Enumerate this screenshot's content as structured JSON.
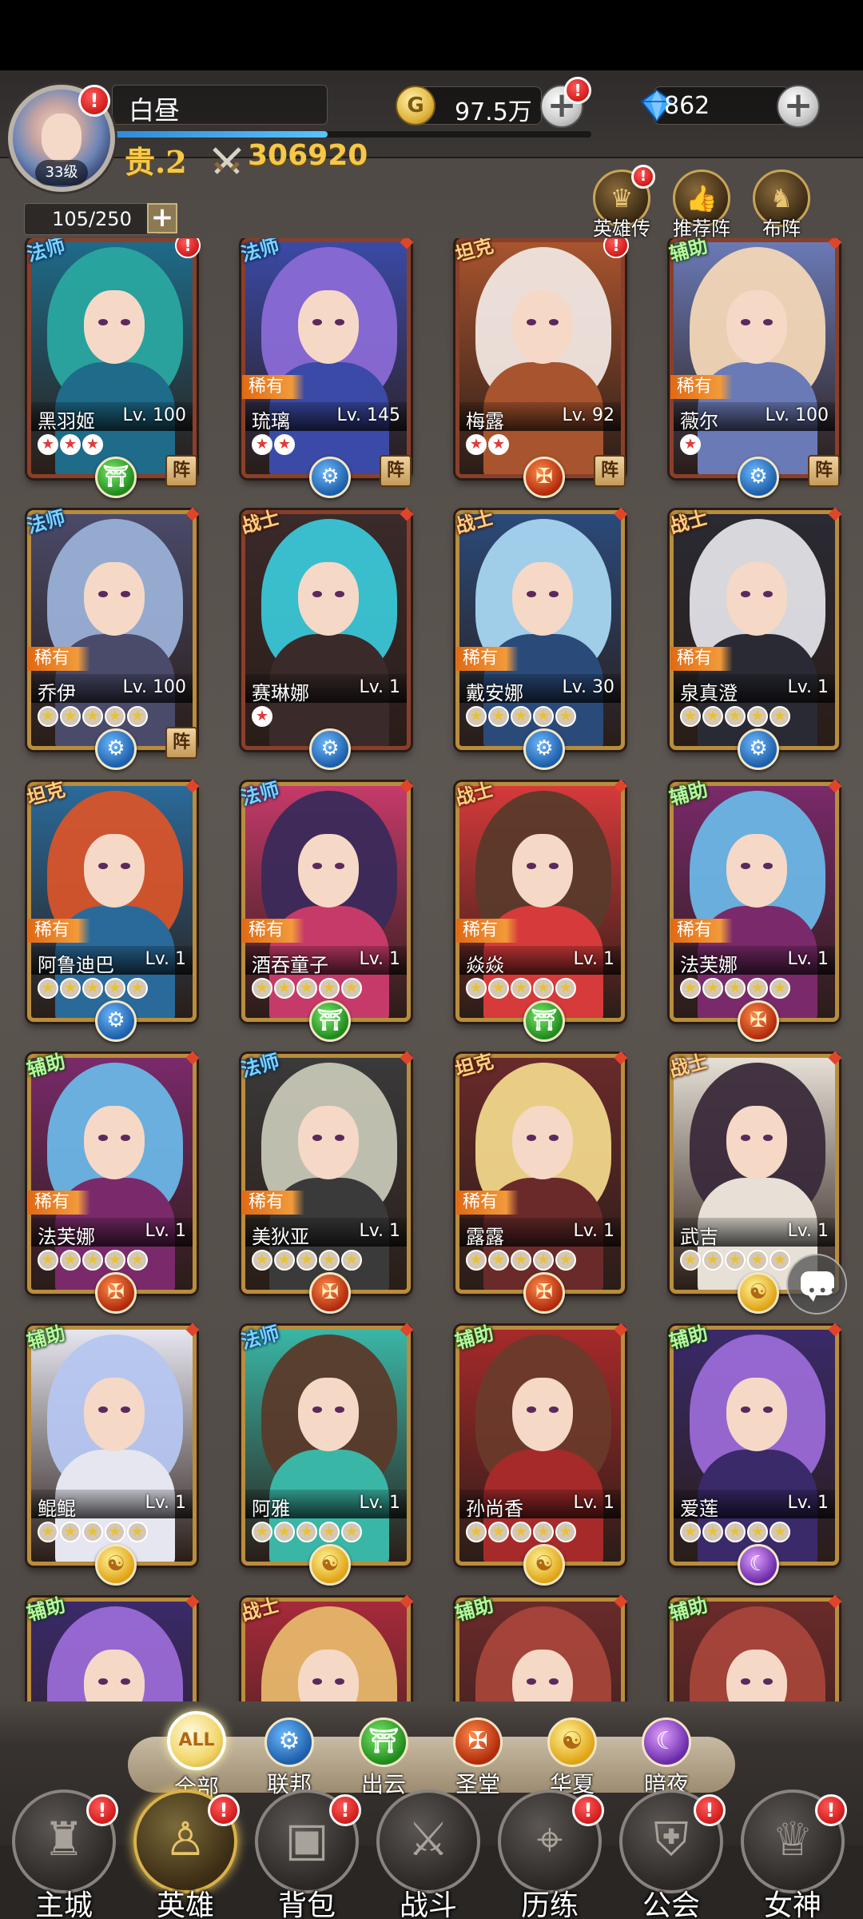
{
  "player": {
    "name": "白昼",
    "level": "33级",
    "vip": "贵.2",
    "power": "306920",
    "exp_progress": 0.45,
    "avatar_badge": "!"
  },
  "resources": {
    "gold": "97.5万",
    "gold_icon": "G",
    "gold_badge": "!",
    "gems": "862"
  },
  "roster": {
    "count": "105/250"
  },
  "side_buttons": [
    {
      "label": "英雄传",
      "icon": "crown-icon",
      "glyph": "♛",
      "badge": "!"
    },
    {
      "label": "推荐阵",
      "icon": "thumbs-up-icon",
      "glyph": "👍"
    },
    {
      "label": "布阵",
      "icon": "horse-icon",
      "glyph": "♞"
    }
  ],
  "heroes": [
    {
      "name": "黑羽姬",
      "level": "Lv. 100",
      "role": "法师",
      "role_type": "mage",
      "rare": "",
      "stars": 3,
      "star_color": "red",
      "faction": "green",
      "faction_glyph": "⛩",
      "formation": "阵",
      "badge": "!",
      "frame": "red",
      "hair": "#2aa6a0",
      "body": "#1e6b8a"
    },
    {
      "name": "琉璃",
      "level": "Lv. 145",
      "role": "法师",
      "role_type": "mage",
      "rare": "稀有",
      "stars": 2,
      "star_color": "red",
      "faction": "blue",
      "faction_glyph": "⚙",
      "formation": "阵",
      "badge": "",
      "frame": "red",
      "hair": "#8a6ad6",
      "body": "#3a4aa6"
    },
    {
      "name": "梅露",
      "level": "Lv. 92",
      "role": "坦克",
      "role_type": "tank",
      "rare": "",
      "stars": 2,
      "star_color": "red",
      "faction": "red",
      "faction_glyph": "✠",
      "formation": "阵",
      "badge": "!",
      "frame": "red",
      "hair": "#f0e6e0",
      "body": "#a8542e"
    },
    {
      "name": "薇尔",
      "level": "Lv. 100",
      "role": "辅助",
      "role_type": "support",
      "rare": "稀有",
      "stars": 1,
      "star_color": "red",
      "faction": "blue",
      "faction_glyph": "⚙",
      "formation": "阵",
      "badge": "",
      "frame": "red",
      "hair": "#f2d6b6",
      "body": "#6a7ab6"
    },
    {
      "name": "乔伊",
      "level": "Lv. 100",
      "role": "法师",
      "role_type": "mage",
      "rare": "稀有",
      "stars": 5,
      "star_color": "gold",
      "faction": "blue",
      "faction_glyph": "⚙",
      "formation": "阵",
      "badge": "",
      "frame": "gold",
      "hair": "#9ab0d6",
      "body": "#4a4a6a"
    },
    {
      "name": "赛琳娜",
      "level": "Lv. 1",
      "role": "战士",
      "role_type": "warrior",
      "rare": "",
      "stars": 1,
      "star_color": "red",
      "faction": "blue",
      "faction_glyph": "⚙",
      "formation": "",
      "badge": "",
      "frame": "red",
      "hair": "#3ac6d6",
      "body": "#3a2a2a"
    },
    {
      "name": "戴安娜",
      "level": "Lv. 30",
      "role": "战士",
      "role_type": "warrior",
      "rare": "稀有",
      "stars": 5,
      "star_color": "gold",
      "faction": "blue",
      "faction_glyph": "⚙",
      "formation": "",
      "badge": "",
      "frame": "gold",
      "hair": "#a6d6f0",
      "body": "#2a4a7a"
    },
    {
      "name": "泉真澄",
      "level": "Lv. 1",
      "role": "战士",
      "role_type": "warrior",
      "rare": "稀有",
      "stars": 5,
      "star_color": "gold",
      "faction": "blue",
      "faction_glyph": "⚙",
      "formation": "",
      "badge": "",
      "frame": "gold",
      "hair": "#e0e0e6",
      "body": "#2a2a34"
    },
    {
      "name": "阿鲁迪巴",
      "level": "Lv. 1",
      "role": "坦克",
      "role_type": "tank",
      "rare": "稀有",
      "stars": 5,
      "star_color": "gold",
      "faction": "blue",
      "faction_glyph": "⚙",
      "formation": "",
      "badge": "",
      "frame": "gold",
      "hair": "#d6542a",
      "body": "#2a6a9a"
    },
    {
      "name": "酒吞童子",
      "level": "Lv. 1",
      "role": "法师",
      "role_type": "mage",
      "rare": "稀有",
      "stars": 5,
      "star_color": "gold",
      "faction": "green",
      "faction_glyph": "⛩",
      "formation": "",
      "badge": "",
      "frame": "gold",
      "hair": "#3a2a5a",
      "body": "#c63a6a"
    },
    {
      "name": "焱焱",
      "level": "Lv. 1",
      "role": "战士",
      "role_type": "warrior",
      "rare": "稀有",
      "stars": 5,
      "star_color": "gold",
      "faction": "green",
      "faction_glyph": "⛩",
      "formation": "",
      "badge": "",
      "frame": "gold",
      "hair": "#5a3a2a",
      "body": "#d63a3a"
    },
    {
      "name": "法芙娜",
      "level": "Lv. 1",
      "role": "辅助",
      "role_type": "support",
      "rare": "稀有",
      "stars": 5,
      "star_color": "gold",
      "faction": "red",
      "faction_glyph": "✠",
      "formation": "",
      "badge": "",
      "frame": "gold",
      "hair": "#6ab6e6",
      "body": "#7a2a6a"
    },
    {
      "name": "法芙娜",
      "level": "Lv. 1",
      "role": "辅助",
      "role_type": "support",
      "rare": "稀有",
      "stars": 5,
      "star_color": "gold",
      "faction": "red",
      "faction_glyph": "✠",
      "formation": "",
      "badge": "",
      "frame": "gold",
      "hair": "#6ab6e6",
      "body": "#7a2a6a"
    },
    {
      "name": "美狄亚",
      "level": "Lv. 1",
      "role": "法师",
      "role_type": "mage",
      "rare": "稀有",
      "stars": 5,
      "star_color": "gold",
      "faction": "red",
      "faction_glyph": "✠",
      "formation": "",
      "badge": "",
      "frame": "gold",
      "hair": "#c6c6b6",
      "body": "#3a3a3a"
    },
    {
      "name": "露露",
      "level": "Lv. 1",
      "role": "坦克",
      "role_type": "tank",
      "rare": "稀有",
      "stars": 5,
      "star_color": "gold",
      "faction": "red",
      "faction_glyph": "✠",
      "formation": "",
      "badge": "",
      "frame": "gold",
      "hair": "#f0d68a",
      "body": "#6a2a2a"
    },
    {
      "name": "武吉",
      "level": "Lv. 1",
      "role": "战士",
      "role_type": "warrior",
      "rare": "",
      "stars": 5,
      "star_color": "gold",
      "faction": "yellow",
      "faction_glyph": "☯",
      "formation": "",
      "badge": "",
      "frame": "gold",
      "hair": "#3a2a3a",
      "body": "#e6e0d6"
    },
    {
      "name": "鲲鲲",
      "level": "Lv. 1",
      "role": "辅助",
      "role_type": "support",
      "rare": "",
      "stars": 5,
      "star_color": "gold",
      "faction": "yellow",
      "faction_glyph": "☯",
      "formation": "",
      "badge": "",
      "frame": "gold",
      "hair": "#b6c6f0",
      "body": "#e6e6f0"
    },
    {
      "name": "阿雅",
      "level": "Lv. 1",
      "role": "法师",
      "role_type": "mage",
      "rare": "",
      "stars": 5,
      "star_color": "gold",
      "faction": "yellow",
      "faction_glyph": "☯",
      "formation": "",
      "badge": "",
      "frame": "gold",
      "hair": "#5a3a2a",
      "body": "#3ab6a6"
    },
    {
      "name": "孙尚香",
      "level": "Lv. 1",
      "role": "辅助",
      "role_type": "support",
      "rare": "",
      "stars": 5,
      "star_color": "gold",
      "faction": "yellow",
      "faction_glyph": "☯",
      "formation": "",
      "badge": "",
      "frame": "gold",
      "hair": "#6a3a2a",
      "body": "#a62a2a"
    },
    {
      "name": "爱莲",
      "level": "Lv. 1",
      "role": "辅助",
      "role_type": "support",
      "rare": "",
      "stars": 5,
      "star_color": "gold",
      "faction": "purple",
      "faction_glyph": "☾",
      "formation": "",
      "badge": "",
      "frame": "gold",
      "hair": "#9a6ad6",
      "body": "#3a2a6a"
    },
    {
      "name": "",
      "level": "",
      "role": "辅助",
      "role_type": "support",
      "rare": "",
      "stars": 0,
      "star_color": "gold",
      "faction": "",
      "faction_glyph": "",
      "formation": "",
      "badge": "",
      "frame": "gold",
      "hair": "#9a6ad6",
      "body": "#3a2a6a"
    },
    {
      "name": "",
      "level": "",
      "role": "战士",
      "role_type": "warrior",
      "rare": "",
      "stars": 0,
      "star_color": "gold",
      "faction": "",
      "faction_glyph": "",
      "formation": "",
      "badge": "",
      "frame": "gold",
      "hair": "#e6b66a",
      "body": "#a62a3a"
    },
    {
      "name": "",
      "level": "",
      "role": "辅助",
      "role_type": "support",
      "rare": "",
      "stars": 0,
      "star_color": "gold",
      "faction": "",
      "faction_glyph": "",
      "formation": "",
      "badge": "",
      "frame": "gold",
      "hair": "#a6443a",
      "body": "#6a2a2a"
    },
    {
      "name": "",
      "level": "",
      "role": "辅助",
      "role_type": "support",
      "rare": "",
      "stars": 0,
      "star_color": "gold",
      "faction": "",
      "faction_glyph": "",
      "formation": "",
      "badge": "",
      "frame": "gold",
      "hair": "#a6443a",
      "body": "#6a2a2a"
    }
  ],
  "faction_tabs": [
    {
      "label": "全部",
      "icon": "all-factions-icon",
      "glyph": "ALL",
      "color": "active"
    },
    {
      "label": "联邦",
      "icon": "gear-icon",
      "glyph": "⚙",
      "color": "blue"
    },
    {
      "label": "出云",
      "icon": "torii-icon",
      "glyph": "⛩",
      "color": "green"
    },
    {
      "label": "圣堂",
      "icon": "cross-icon",
      "glyph": "✠",
      "color": "red"
    },
    {
      "label": "华夏",
      "icon": "yin-yang-icon",
      "glyph": "☯",
      "color": "yellow"
    },
    {
      "label": "暗夜",
      "icon": "moon-star-icon",
      "glyph": "☾",
      "color": "purple"
    }
  ],
  "nav": [
    {
      "label": "主城",
      "icon": "castle-icon",
      "glyph": "♜",
      "badge": "!",
      "active": false
    },
    {
      "label": "英雄",
      "icon": "hooded-hero-icon",
      "glyph": "♙",
      "badge": "!",
      "active": true
    },
    {
      "label": "背包",
      "icon": "backpack-icon",
      "glyph": "▣",
      "badge": "!",
      "active": false
    },
    {
      "label": "战斗",
      "icon": "crossed-swords-icon",
      "glyph": "⚔",
      "badge": "",
      "active": false
    },
    {
      "label": "历练",
      "icon": "map-icon",
      "glyph": "⌖",
      "badge": "!",
      "active": false
    },
    {
      "label": "公会",
      "icon": "shield-icon",
      "glyph": "⛨",
      "badge": "!",
      "active": false
    },
    {
      "label": "女神",
      "icon": "goddess-icon",
      "glyph": "♕",
      "badge": "!",
      "active": false
    }
  ],
  "colors": {
    "accent_gold": "#f6c847",
    "badge_red": "#d01b1b",
    "rare_orange": "#f29a3a"
  }
}
